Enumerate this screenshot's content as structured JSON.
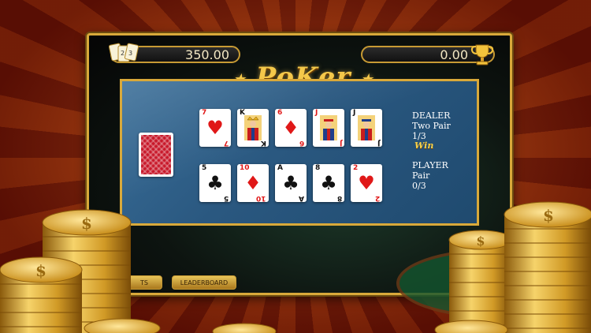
{
  "header": {
    "chips_value": "350.00",
    "winnings_value": "0.00",
    "logo_text": "PoKer"
  },
  "icons": {
    "chips": "chips-icon",
    "trophy": "trophy-icon",
    "card_back": "card-back"
  },
  "colors": {
    "gold": "#d9a93a",
    "panel_blue": "#2a5880",
    "hearts_diamonds": "#e01818"
  },
  "dealer": {
    "title": "DEALER",
    "hand": "Two Pair",
    "score": "1/3",
    "result": "Win",
    "cards": [
      {
        "rank": "7",
        "suit": "♥",
        "color": "red"
      },
      {
        "rank": "K",
        "suit": "♣",
        "color": "black",
        "face": true
      },
      {
        "rank": "6",
        "suit": "♦",
        "color": "red"
      },
      {
        "rank": "J",
        "suit": "♦",
        "color": "red",
        "face": true
      },
      {
        "rank": "J",
        "suit": "♣",
        "color": "black",
        "face": true
      }
    ]
  },
  "player": {
    "title": "PLAYER",
    "hand": "Pair",
    "score": "0/3",
    "cards": [
      {
        "rank": "5",
        "suit": "♣",
        "color": "black"
      },
      {
        "rank": "10",
        "suit": "♦",
        "color": "red"
      },
      {
        "rank": "A",
        "suit": "♣",
        "color": "black"
      },
      {
        "rank": "8",
        "suit": "♣",
        "color": "black"
      },
      {
        "rank": "2",
        "suit": "♥",
        "color": "red"
      }
    ]
  },
  "buttons": {
    "left_label": "TS",
    "leaderboard_label": "LEADERBOARD"
  }
}
